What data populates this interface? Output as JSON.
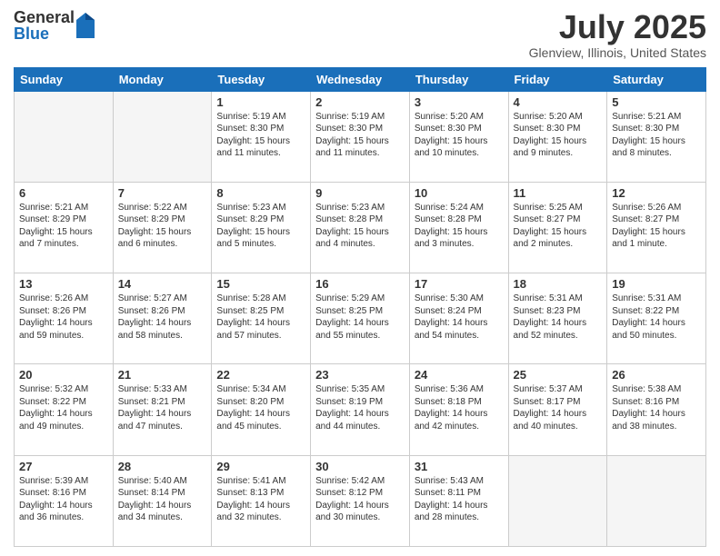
{
  "logo": {
    "general": "General",
    "blue": "Blue"
  },
  "header": {
    "month": "July 2025",
    "location": "Glenview, Illinois, United States"
  },
  "weekdays": [
    "Sunday",
    "Monday",
    "Tuesday",
    "Wednesday",
    "Thursday",
    "Friday",
    "Saturday"
  ],
  "weeks": [
    [
      {
        "day": "",
        "info": ""
      },
      {
        "day": "",
        "info": ""
      },
      {
        "day": "1",
        "info": "Sunrise: 5:19 AM\nSunset: 8:30 PM\nDaylight: 15 hours and 11 minutes."
      },
      {
        "day": "2",
        "info": "Sunrise: 5:19 AM\nSunset: 8:30 PM\nDaylight: 15 hours and 11 minutes."
      },
      {
        "day": "3",
        "info": "Sunrise: 5:20 AM\nSunset: 8:30 PM\nDaylight: 15 hours and 10 minutes."
      },
      {
        "day": "4",
        "info": "Sunrise: 5:20 AM\nSunset: 8:30 PM\nDaylight: 15 hours and 9 minutes."
      },
      {
        "day": "5",
        "info": "Sunrise: 5:21 AM\nSunset: 8:30 PM\nDaylight: 15 hours and 8 minutes."
      }
    ],
    [
      {
        "day": "6",
        "info": "Sunrise: 5:21 AM\nSunset: 8:29 PM\nDaylight: 15 hours and 7 minutes."
      },
      {
        "day": "7",
        "info": "Sunrise: 5:22 AM\nSunset: 8:29 PM\nDaylight: 15 hours and 6 minutes."
      },
      {
        "day": "8",
        "info": "Sunrise: 5:23 AM\nSunset: 8:29 PM\nDaylight: 15 hours and 5 minutes."
      },
      {
        "day": "9",
        "info": "Sunrise: 5:23 AM\nSunset: 8:28 PM\nDaylight: 15 hours and 4 minutes."
      },
      {
        "day": "10",
        "info": "Sunrise: 5:24 AM\nSunset: 8:28 PM\nDaylight: 15 hours and 3 minutes."
      },
      {
        "day": "11",
        "info": "Sunrise: 5:25 AM\nSunset: 8:27 PM\nDaylight: 15 hours and 2 minutes."
      },
      {
        "day": "12",
        "info": "Sunrise: 5:26 AM\nSunset: 8:27 PM\nDaylight: 15 hours and 1 minute."
      }
    ],
    [
      {
        "day": "13",
        "info": "Sunrise: 5:26 AM\nSunset: 8:26 PM\nDaylight: 14 hours and 59 minutes."
      },
      {
        "day": "14",
        "info": "Sunrise: 5:27 AM\nSunset: 8:26 PM\nDaylight: 14 hours and 58 minutes."
      },
      {
        "day": "15",
        "info": "Sunrise: 5:28 AM\nSunset: 8:25 PM\nDaylight: 14 hours and 57 minutes."
      },
      {
        "day": "16",
        "info": "Sunrise: 5:29 AM\nSunset: 8:25 PM\nDaylight: 14 hours and 55 minutes."
      },
      {
        "day": "17",
        "info": "Sunrise: 5:30 AM\nSunset: 8:24 PM\nDaylight: 14 hours and 54 minutes."
      },
      {
        "day": "18",
        "info": "Sunrise: 5:31 AM\nSunset: 8:23 PM\nDaylight: 14 hours and 52 minutes."
      },
      {
        "day": "19",
        "info": "Sunrise: 5:31 AM\nSunset: 8:22 PM\nDaylight: 14 hours and 50 minutes."
      }
    ],
    [
      {
        "day": "20",
        "info": "Sunrise: 5:32 AM\nSunset: 8:22 PM\nDaylight: 14 hours and 49 minutes."
      },
      {
        "day": "21",
        "info": "Sunrise: 5:33 AM\nSunset: 8:21 PM\nDaylight: 14 hours and 47 minutes."
      },
      {
        "day": "22",
        "info": "Sunrise: 5:34 AM\nSunset: 8:20 PM\nDaylight: 14 hours and 45 minutes."
      },
      {
        "day": "23",
        "info": "Sunrise: 5:35 AM\nSunset: 8:19 PM\nDaylight: 14 hours and 44 minutes."
      },
      {
        "day": "24",
        "info": "Sunrise: 5:36 AM\nSunset: 8:18 PM\nDaylight: 14 hours and 42 minutes."
      },
      {
        "day": "25",
        "info": "Sunrise: 5:37 AM\nSunset: 8:17 PM\nDaylight: 14 hours and 40 minutes."
      },
      {
        "day": "26",
        "info": "Sunrise: 5:38 AM\nSunset: 8:16 PM\nDaylight: 14 hours and 38 minutes."
      }
    ],
    [
      {
        "day": "27",
        "info": "Sunrise: 5:39 AM\nSunset: 8:16 PM\nDaylight: 14 hours and 36 minutes."
      },
      {
        "day": "28",
        "info": "Sunrise: 5:40 AM\nSunset: 8:14 PM\nDaylight: 14 hours and 34 minutes."
      },
      {
        "day": "29",
        "info": "Sunrise: 5:41 AM\nSunset: 8:13 PM\nDaylight: 14 hours and 32 minutes."
      },
      {
        "day": "30",
        "info": "Sunrise: 5:42 AM\nSunset: 8:12 PM\nDaylight: 14 hours and 30 minutes."
      },
      {
        "day": "31",
        "info": "Sunrise: 5:43 AM\nSunset: 8:11 PM\nDaylight: 14 hours and 28 minutes."
      },
      {
        "day": "",
        "info": ""
      },
      {
        "day": "",
        "info": ""
      }
    ]
  ]
}
